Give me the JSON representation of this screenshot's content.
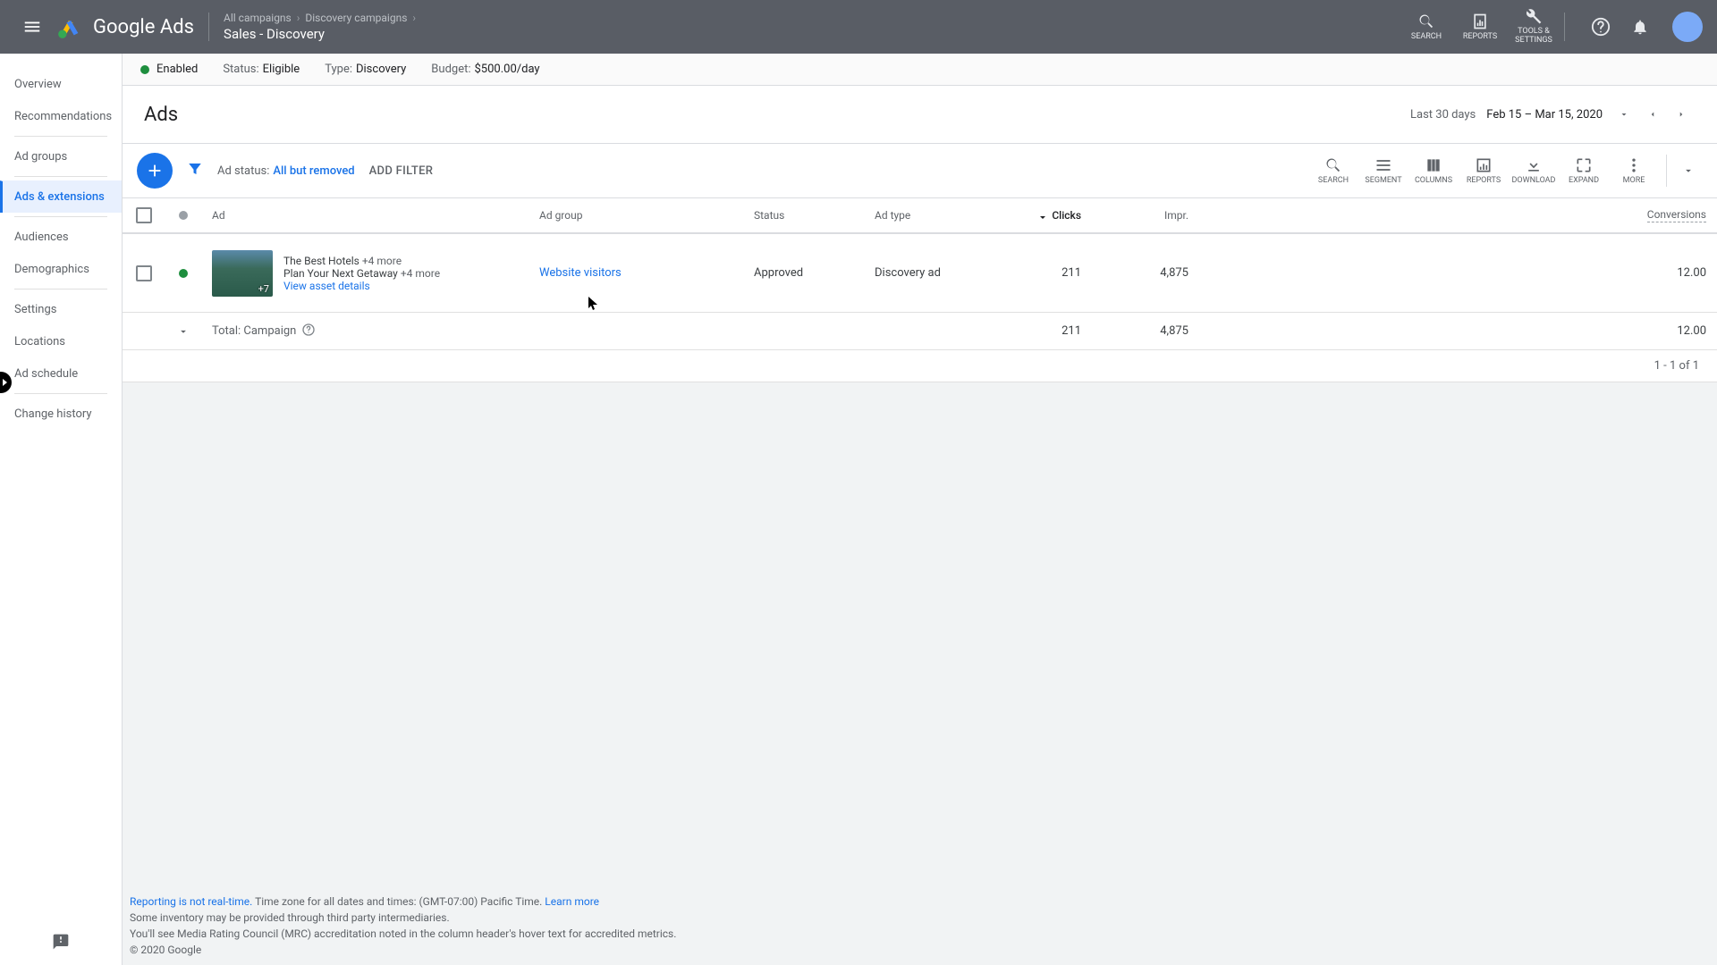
{
  "header": {
    "product": "Google Ads",
    "crumb1": "All campaigns",
    "crumb2": "Discovery campaigns",
    "campaign": "Sales - Discovery",
    "top_actions": {
      "search": "SEARCH",
      "reports": "REPORTS",
      "tools": "TOOLS & SETTINGS"
    }
  },
  "sidebar": {
    "items": [
      "Overview",
      "Recommendations",
      "Ad groups",
      "Ads & extensions",
      "Audiences",
      "Demographics",
      "Settings",
      "Locations",
      "Ad schedule",
      "Change history"
    ]
  },
  "statusbar": {
    "enabled": "Enabled",
    "status_label": "Status:",
    "status": "Eligible",
    "type_label": "Type:",
    "type": "Discovery",
    "budget_label": "Budget:",
    "budget": "$500.00/day"
  },
  "page": {
    "title": "Ads",
    "date_label": "Last 30 days",
    "date_range": "Feb 15 – Mar 15, 2020"
  },
  "toolbar": {
    "chip_label": "Ad status:",
    "chip_value": "All but removed",
    "add_filter": "ADD FILTER",
    "actions": {
      "search": "SEARCH",
      "segment": "SEGMENT",
      "columns": "COLUMNS",
      "reports": "REPORTS",
      "download": "DOWNLOAD",
      "expand": "EXPAND",
      "more": "MORE"
    }
  },
  "table": {
    "headers": {
      "ad": "Ad",
      "adgroup": "Ad group",
      "status": "Status",
      "adtype": "Ad type",
      "clicks": "Clicks",
      "impr": "Impr.",
      "conv": "Conversions"
    },
    "row": {
      "line1": "The Best Hotels",
      "line1more": "+4 more",
      "line2": "Plan Your Next Getaway",
      "line2more": "+4 more",
      "view": "View asset details",
      "thumb_badge": "+7",
      "adgroup": "Website visitors",
      "status": "Approved",
      "type": "Discovery ad",
      "clicks": "211",
      "impr": "4,875",
      "conv": "12.00"
    },
    "total": {
      "label": "Total: Campaign",
      "clicks": "211",
      "impr": "4,875",
      "conv": "12.00"
    },
    "pager": "1 - 1 of 1"
  },
  "footer": {
    "l1a": "Reporting is not real-time.",
    "l1b": " Time zone for all dates and times: (GMT-07:00) Pacific Time. ",
    "l1c": "Learn more",
    "l2": "Some inventory may be provided through third party intermediaries.",
    "l3": "You'll see Media Rating Council (MRC) accreditation noted in the column header's hover text for accredited metrics.",
    "copy": "© 2020 Google"
  }
}
